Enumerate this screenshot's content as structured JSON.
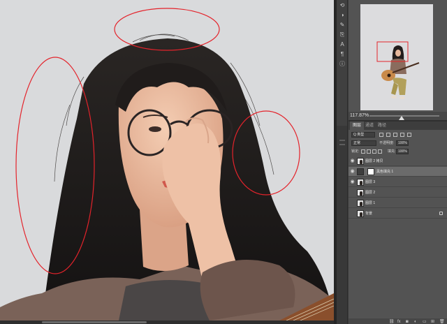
{
  "navigator": {
    "zoom": "117.87%",
    "zoom_fraction": 0.46
  },
  "layers": {
    "tabs": [
      "图层",
      "通道",
      "路径"
    ],
    "kind_filter": "Q 类型",
    "blend_mode": "正常",
    "opacity_label": "不透明度:",
    "opacity": "100%",
    "lock_label": "锁定:",
    "fill_label": "填充:",
    "fill": "100%",
    "items": [
      {
        "name": "图层 2 拷贝",
        "visible": true,
        "selected": false,
        "kind": "pixel"
      },
      {
        "name": "黑色填充 1",
        "visible": true,
        "selected": true,
        "kind": "adjustment"
      },
      {
        "name": "图层 3",
        "visible": true,
        "selected": false,
        "kind": "pixel"
      },
      {
        "name": "图层 2",
        "visible": false,
        "selected": false,
        "kind": "pixel"
      },
      {
        "name": "图层 1",
        "visible": false,
        "selected": false,
        "kind": "pixel"
      },
      {
        "name": "背景",
        "visible": false,
        "selected": false,
        "kind": "background"
      }
    ]
  },
  "colors": {
    "annotation_red": "#e4232b",
    "canvas_bg": "#d9dadc",
    "panel_bg": "#535353",
    "selected_row": "#6b6b6b"
  },
  "icons": {
    "toolstrip": [
      "history-icon",
      "adjust-icon",
      "brush-icon",
      "clone-icon",
      "type-icon",
      "paragraph-icon",
      "info-icon"
    ],
    "footer": [
      "link-icon",
      "fx-icon",
      "mask-icon",
      "adjustment-icon",
      "group-icon",
      "new-layer-icon",
      "trash-icon"
    ]
  }
}
